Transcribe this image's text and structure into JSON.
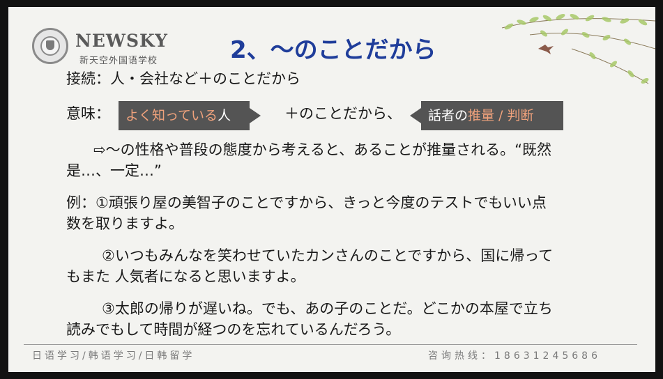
{
  "logo": {
    "name": "NEWSKY",
    "subtitle": "新天空外国语学校"
  },
  "slide": {
    "title": "2、～のことだから",
    "connection": "接続：人・会社など＋のことだから",
    "meaning_label": "意味：",
    "callout_left": {
      "text_highlight": "よく知っている",
      "text_rest": "人"
    },
    "meaning_middle": "＋のことだから、",
    "callout_right": {
      "text_plain": "話者の",
      "text_highlight": "推量 / 判断"
    },
    "explanation_line1": "⇨～の性格や普段の態度から考えると、あることが推量される。“既然",
    "explanation_line2": "是…、一定…”",
    "example1_line1": "例：①頑張り屋の美智子のことですから、きっと今度のテストでもいい点",
    "example1_line2": "数を取りますよ。",
    "example2_line1": "②いつもみんなを笑わせていたカンさんのことですから、国に帰って",
    "example2_line2": "もまた 人気者になると思いますよ。",
    "example3_line1": "③太郎の帰りが遅いね。でも、あの子のことだ。どこかの本屋で立ち",
    "example3_line2": "読みでもして時間が経つのを忘れているんだろう。"
  },
  "footer": {
    "left": "日语学习/韩语学习/日韩留学",
    "right": "咨询热线：18631245686"
  },
  "colors": {
    "title": "#1f3d9a",
    "callout_bg": "#545454",
    "callout_highlight": "#f0a27c",
    "slide_bg": "#f3f3f0"
  }
}
